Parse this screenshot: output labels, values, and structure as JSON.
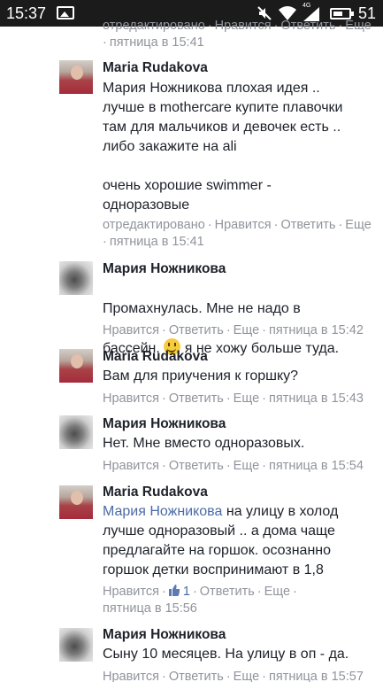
{
  "status_bar": {
    "time": "15:37",
    "signal_label": "4G",
    "battery": "51",
    "battery_level_percent": 51,
    "icons": [
      "gallery-icon",
      "mute-icon",
      "wifi-icon",
      "signal-icon",
      "battery-icon"
    ]
  },
  "top_partial": {
    "edited": "отредактировано",
    "like": "Нравится",
    "reply": "Ответить",
    "more": "Еще",
    "time": "пятница в 15:41"
  },
  "comments": [
    {
      "author": "Maria Rudakova",
      "text": "Мария Ножникова плохая идея ..\nлучше в mothercare купите плавочки\nтам для мальчиков и девочек есть ..\nлибо закажите на ali\n\nочень хорошие swimmer -\nодноразовые",
      "edited": "отредактировано",
      "like": "Нравится",
      "reply": "Ответить",
      "more": "Еще",
      "time": "пятница в 15:41"
    },
    {
      "author": "Мария Ножникова",
      "text_line1": "Промахнулась. Мне не надо в",
      "text_line2_a": "бассейн.",
      "text_line2_b": " я не хожу больше туда.",
      "like": "Нравится",
      "reply": "Ответить",
      "more": "Еще",
      "time": "пятница в 15:42"
    },
    {
      "author": "Maria Rudakova",
      "text": "Вам для приучения к горшку?",
      "like": "Нравится",
      "reply": "Ответить",
      "more": "Еще",
      "time": "пятница в 15:43"
    },
    {
      "author": "Мария Ножникова",
      "text": "Нет. Мне вместо одноразовых.",
      "like": "Нравится",
      "reply": "Ответить",
      "more": "Еще",
      "time": "пятница в 15:54"
    },
    {
      "author": "Maria Rudakova",
      "mention": "Мария Ножникова",
      "text_after_mention": " на улицу в холод\nлучше одноразовый .. а дома чаще\nпредлагайте на горшок. осознанно\nгоршок детки воспринимают в 1,8",
      "like": "Нравится",
      "like_count": "1",
      "reply": "Ответить",
      "more": "Еще",
      "time": "пятница в 15:56"
    },
    {
      "author": "Мария Ножникова",
      "text": "Сыну 10 месяцев. На улицу в оп - да.",
      "like": "Нравится",
      "reply": "Ответить",
      "more": "Еще",
      "time": "пятница в 15:57"
    }
  ]
}
